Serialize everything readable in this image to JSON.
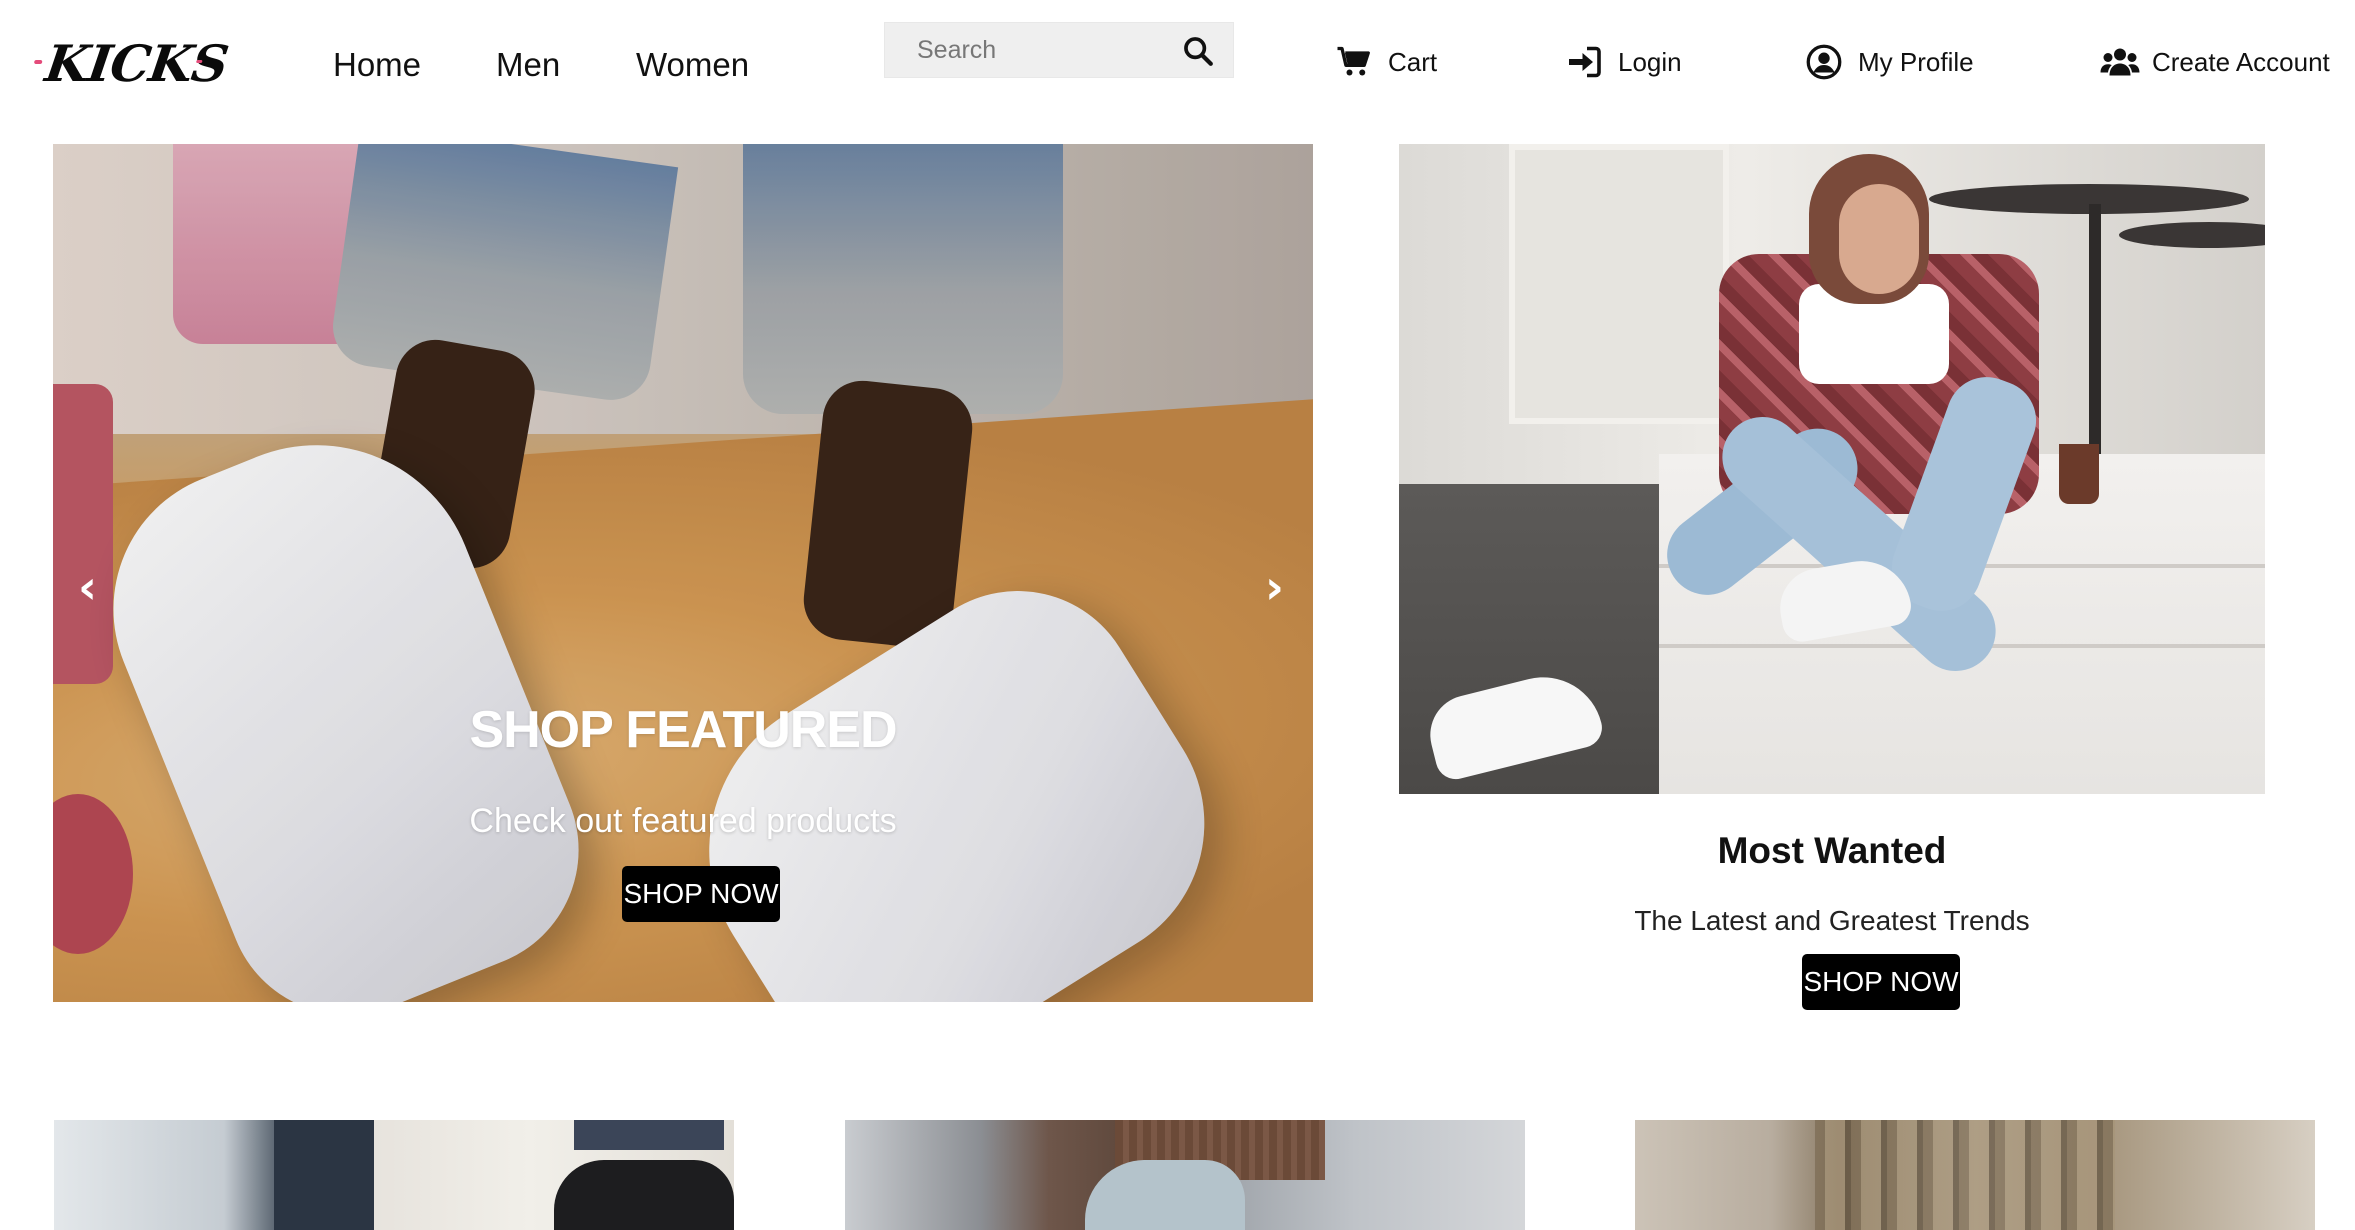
{
  "brand": {
    "logo_text": "KICKS"
  },
  "nav": {
    "links": [
      {
        "label": "Home"
      },
      {
        "label": "Men"
      },
      {
        "label": "Women"
      }
    ],
    "search": {
      "placeholder": "Search"
    },
    "actions": {
      "cart": "Cart",
      "login": "Login",
      "profile": "My Profile",
      "create_account": "Create Account"
    }
  },
  "hero": {
    "title": "SHOP FEATURED",
    "subtitle": "Check out featured products",
    "button": "SHOP NOW",
    "prev_glyph": "‹",
    "next_glyph": "›"
  },
  "promo": {
    "title": "Most Wanted",
    "subtitle": "The Latest and Greatest Trends",
    "button": "SHOP NOW"
  },
  "colors": {
    "button_bg": "#000000",
    "button_text": "#ffffff",
    "logo_accent": "#e44b7a"
  },
  "icons": {
    "search": "magnifier-icon",
    "cart": "cart-icon",
    "login": "sign-in-icon",
    "profile": "user-circle-icon",
    "create_account": "users-icon"
  }
}
